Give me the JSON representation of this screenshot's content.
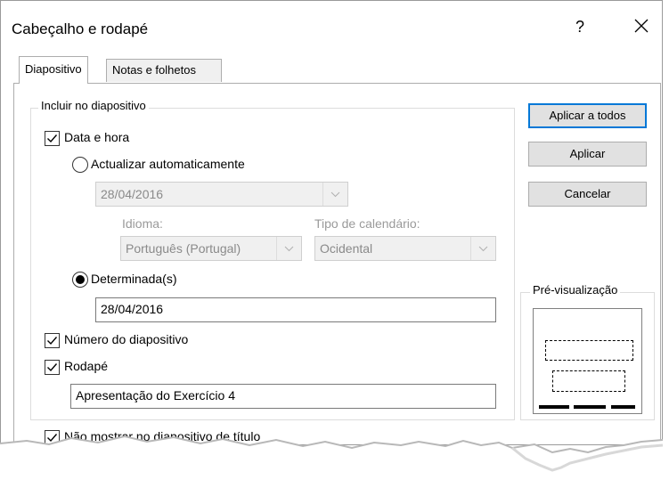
{
  "title": "Cabeçalho e rodapé",
  "help": "?",
  "close": "✕",
  "tabs": [
    "Diapositivo",
    "Notas e folhetos"
  ],
  "group_label": "Incluir no diapositivo",
  "date_time": {
    "label": "Data e hora",
    "checked": true
  },
  "auto_update": {
    "label": "Actualizar automaticamente",
    "selected": false
  },
  "auto_date": {
    "value": "28/04/2016"
  },
  "language": {
    "label": "Idioma:",
    "value": "Português (Portugal)"
  },
  "calendar": {
    "label": "Tipo de calendário:",
    "value": "Ocidental"
  },
  "fixed": {
    "label": "Determinada(s)",
    "selected": true,
    "value": "28/04/2016"
  },
  "slide_number": {
    "label": "Número do diapositivo",
    "checked": true
  },
  "footer": {
    "label": "Rodapé",
    "checked": true,
    "value": "Apresentação do Exercício 4"
  },
  "hide_on_title": {
    "label": "Não mostrar no diapositivo de título",
    "checked": true
  },
  "buttons": {
    "apply_all": "Aplicar a todos",
    "apply": "Aplicar",
    "cancel": "Cancelar"
  },
  "preview_label": "Pré-visualização",
  "colors": {
    "accent": "#0078d7",
    "disabled_text": "#9a9a9a"
  }
}
